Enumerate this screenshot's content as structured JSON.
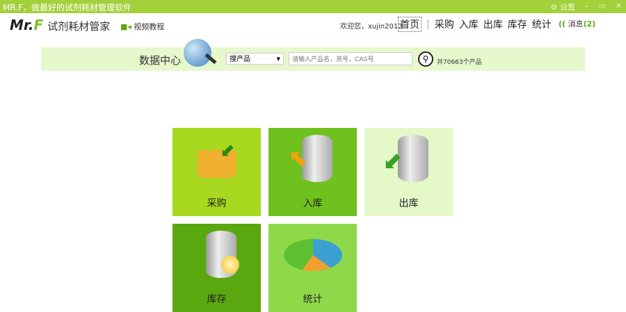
{
  "window": {
    "title": "MR.F，做最好的试剂耗材管理软件",
    "settings": "设置",
    "minimize": "–",
    "restore": "▭",
    "close": "✕"
  },
  "header": {
    "logo_main": "Mr.",
    "logo_f": "F",
    "logo_cn": "试剂耗材管家",
    "video": "视频教程",
    "welcome": "欢迎您，xujin2012",
    "nav": [
      "首页",
      "采购",
      "入库",
      "出库",
      "库存",
      "统计"
    ],
    "separator": "|",
    "messages_label": "消息",
    "messages_count": "(2)"
  },
  "search": {
    "title": "数据中心",
    "select_value": "搜产品",
    "placeholder": "请输入产品名，货号，CAS号",
    "count_text": "共70663个产品"
  },
  "tiles": [
    {
      "label": "采购",
      "color": "#a8d820"
    },
    {
      "label": "入库",
      "color": "#6fc11e"
    },
    {
      "label": "出库",
      "color": "#e4f8c8"
    },
    {
      "label": "库存",
      "color": "#5aa80f"
    },
    {
      "label": "统计",
      "color": "#8fd84a"
    }
  ]
}
